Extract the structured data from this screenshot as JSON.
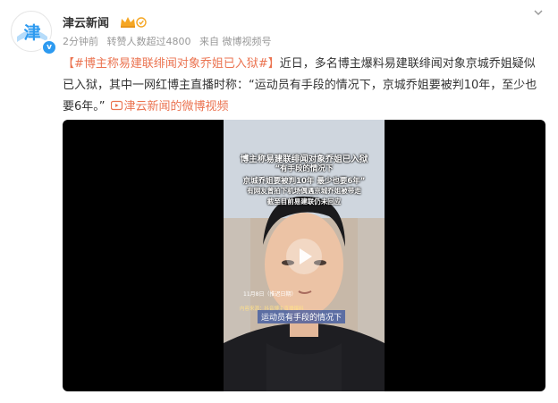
{
  "post": {
    "author": "津云新闻",
    "avatar_text": "津",
    "meta": {
      "time": "2分钟前",
      "reposts": "转赞人数超过4800",
      "source": "来自 微博视频号"
    },
    "content": {
      "topic": "【#博主称易建联绯闻对象乔姐已入狱#】",
      "body": "近日，多名博主爆料易建联绯闻对象京城乔姐疑似已入狱，其中一网红博主直播时称：“运动员有手段的情况下，京城乔姐要被判10年，至少也要6年。”",
      "video_link": "津云新闻的微博视频"
    }
  },
  "video": {
    "captions": {
      "line1": "博主称易建联绯闻对象乔姐已入狱",
      "line2": "“有手段的情况下",
      "line3": "京城乔姐要被判10年 最少也要6年”",
      "line4": "有网友曾拍下机场偶遇京城乔姐被带走",
      "line5": "截至目前易建联仍未回应"
    },
    "date": "11月8日（推迟日期）",
    "source": "内容来源：抖音博主直播爆料",
    "subtitle": "运动员有手段的情况下"
  },
  "colors": {
    "accent": "#eb7350",
    "brand_blue": "#2d9af0"
  },
  "icons": {
    "menu": "chevron-down-icon",
    "vip": "crown-icon",
    "play": "play-icon",
    "verified": "verified-icon"
  }
}
